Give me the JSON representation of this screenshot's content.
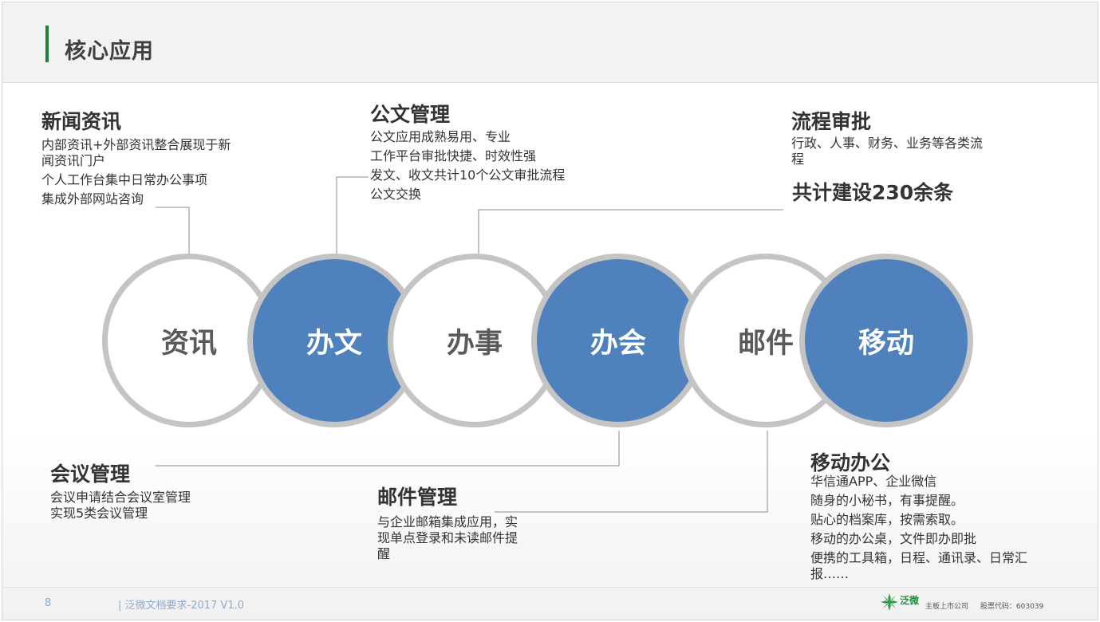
{
  "header": {
    "title": "核心应用"
  },
  "sections": {
    "news": {
      "title": "新闻资讯",
      "lines": [
        "内部资讯+外部资讯整合展现于新",
        "闻资讯门户",
        "个人工作台集中日常办公事项",
        "集成外部网站咨询"
      ]
    },
    "document": {
      "title": "公文管理",
      "lines": [
        "公文应用成熟易用、专业",
        "工作平台审批快捷、时效性强",
        "发文、收文共计10个公文审批流程",
        "公文交换"
      ]
    },
    "workflow": {
      "title": "流程审批",
      "lines": [
        "行政、人事、财务、业务等各类流",
        "程"
      ],
      "highlight": "共计建设230余条"
    },
    "meeting": {
      "title": "会议管理",
      "lines": [
        "会议申请结合会议室管理",
        "实现5类会议管理"
      ]
    },
    "mail": {
      "title": "邮件管理",
      "lines": [
        "与企业邮箱集成应用，实",
        "现单点登录和未读邮件提",
        "醒"
      ]
    },
    "mobile": {
      "title": "移动办公",
      "lines": [
        "华信通APP、企业微信",
        "随身的小秘书，有事提醒。",
        "贴心的档案库，按需索取。",
        "移动的办公桌，文件即办即批",
        "便携的工具箱，日程、通讯录、日常汇",
        "报……"
      ]
    }
  },
  "circles": [
    {
      "label": "资讯",
      "style": "white"
    },
    {
      "label": "办文",
      "style": "blue"
    },
    {
      "label": "办事",
      "style": "white"
    },
    {
      "label": "办会",
      "style": "blue"
    },
    {
      "label": "邮件",
      "style": "white"
    },
    {
      "label": "移动",
      "style": "blue"
    }
  ],
  "colors": {
    "accent_green": "#1e7f3c",
    "circle_blue": "#4f81bd",
    "circle_border": "#c4c4c4"
  },
  "footer": {
    "page_number": "8",
    "doc_label": "| 泛微文档要求-2017 V1.0",
    "logo_text": "泛微",
    "company_note": "主板上市公司",
    "stock_code": "股票代码：603039"
  }
}
